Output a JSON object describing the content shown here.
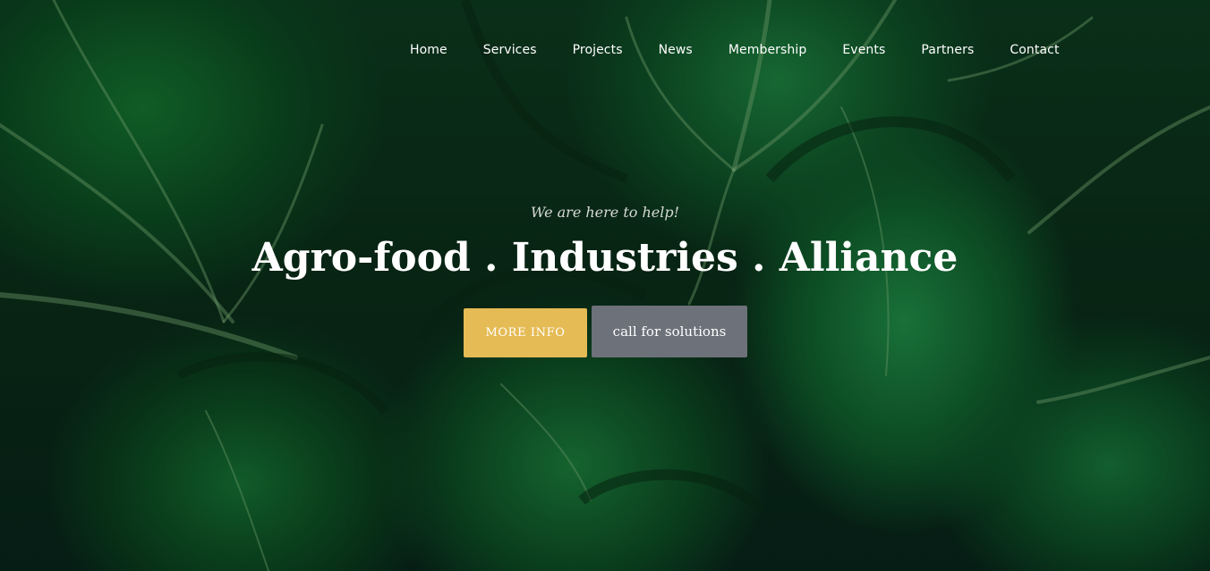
{
  "nav": {
    "items": [
      {
        "label": "Home"
      },
      {
        "label": "Services"
      },
      {
        "label": "Projects"
      },
      {
        "label": "News"
      },
      {
        "label": "Membership"
      },
      {
        "label": "Events"
      },
      {
        "label": "Partners"
      },
      {
        "label": "Contact"
      }
    ]
  },
  "hero": {
    "tagline": "We are here to help!",
    "headline": "Agro-food . Industries . Alliance",
    "primary_button": "MORE INFO",
    "secondary_button": "call for solutions",
    "background_image": "green-leaves-photo"
  },
  "colors": {
    "primary_button": "#e5bb55",
    "secondary_button": "#6d7179",
    "text": "#ffffff"
  }
}
